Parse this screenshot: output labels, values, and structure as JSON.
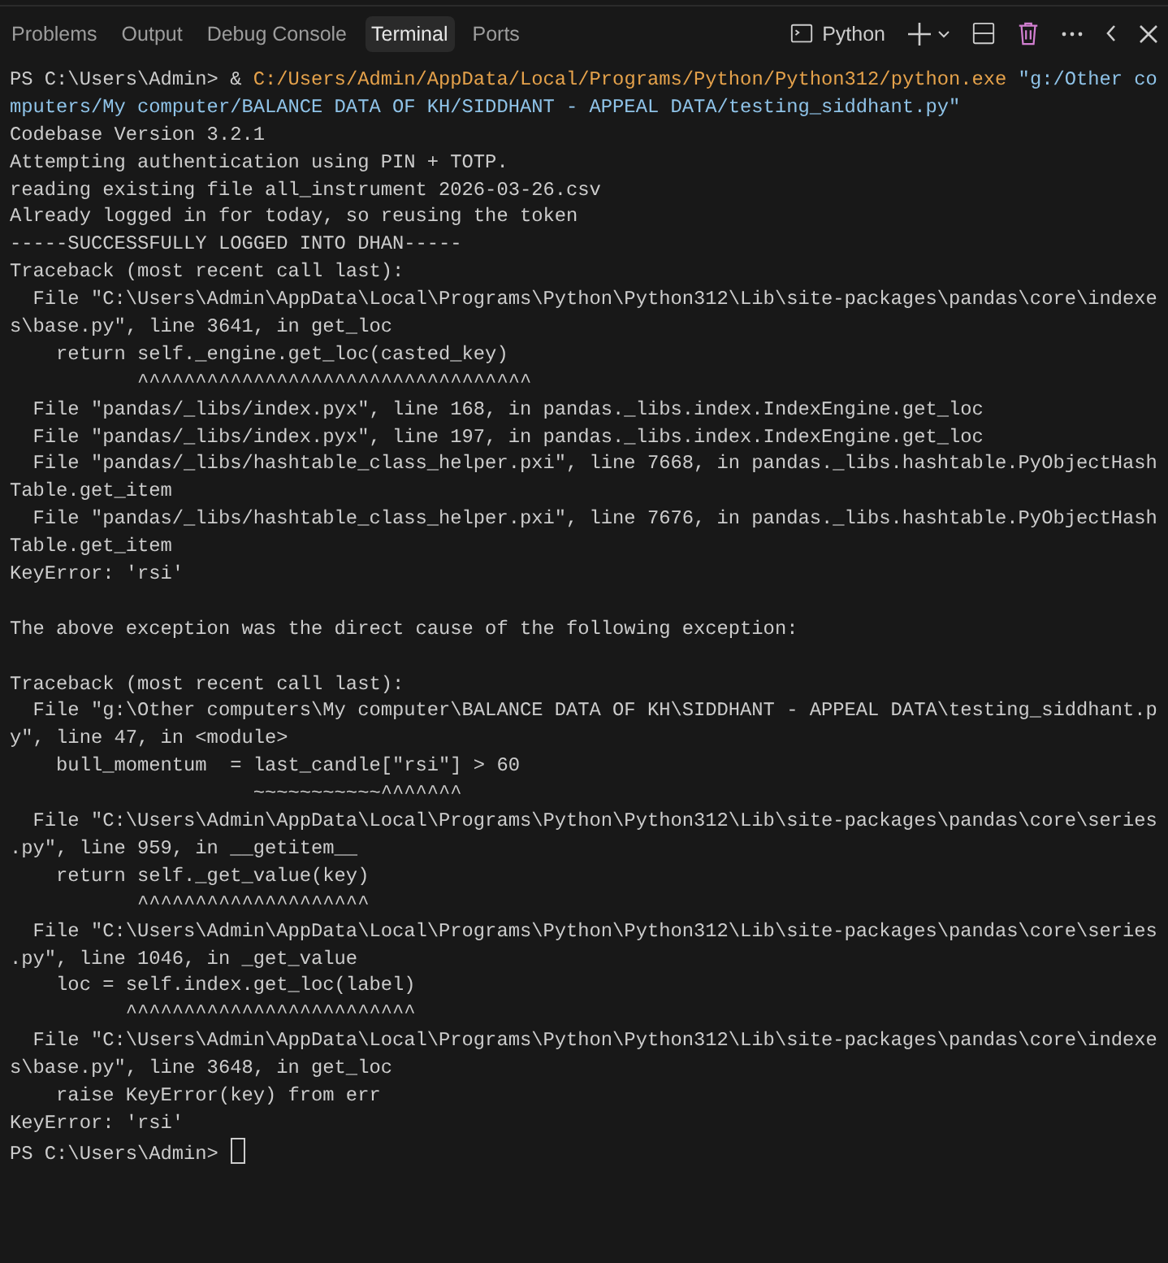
{
  "tabs": [
    {
      "label": "Problems",
      "selected": false
    },
    {
      "label": "Output",
      "selected": false
    },
    {
      "label": "Debug Console",
      "selected": false
    },
    {
      "label": "Terminal",
      "selected": true
    },
    {
      "label": "Ports",
      "selected": false
    }
  ],
  "toolbar": {
    "profile": "Python"
  },
  "terminal": {
    "blocks": [
      {
        "lines": [
          {
            "parts": [
              {
                "text": "PS C:\\Users\\Admin> & ",
                "kind": "plain"
              },
              {
                "text": "C:/Users/Admin/AppData/Local/Programs/Python/Python312/python.exe",
                "kind": "command"
              },
              {
                "text": " \"g:/Other co",
                "kind": "string"
              }
            ]
          },
          {
            "parts": [
              {
                "text": "mputers/My computer/BALANCE DATA OF KH/SIDDHANT - APPEAL DATA/testing_siddhant.py\"",
                "kind": "string"
              }
            ]
          },
          {
            "text": "Codebase Version 3.2.1"
          },
          {
            "text": "Attempting authentication using PIN + TOTP."
          },
          {
            "text": "reading existing file all_instrument 2026-03-26.csv"
          },
          {
            "text": "Already logged in for today, so reusing the token"
          },
          {
            "text": "-----SUCCESSFULLY LOGGED INTO DHAN-----"
          },
          {
            "text": "Traceback (most recent call last):"
          },
          {
            "text": "  File \"C:\\Users\\Admin\\AppData\\Local\\Programs\\Python\\Python312\\Lib\\site-packages\\pandas\\core\\indexe"
          },
          {
            "text": "s\\base.py\", line 3641, in get_loc"
          },
          {
            "text": "    return self._engine.get_loc(casted_key)"
          },
          {
            "text": "           ^^^^^^^^^^^^^^^^^^^^^^^^^^^^^^^^^^"
          },
          {
            "text": "  File \"pandas/_libs/index.pyx\", line 168, in pandas._libs.index.IndexEngine.get_loc"
          },
          {
            "text": "  File \"pandas/_libs/index.pyx\", line 197, in pandas._libs.index.IndexEngine.get_loc"
          },
          {
            "text": "  File \"pandas/_libs/hashtable_class_helper.pxi\", line 7668, in pandas._libs.hashtable.PyObjectHash"
          },
          {
            "text": "Table.get_item"
          },
          {
            "text": "  File \"pandas/_libs/hashtable_class_helper.pxi\", line 7676, in pandas._libs.hashtable.PyObjectHash"
          },
          {
            "text": "Table.get_item"
          },
          {
            "text": "KeyError: 'rsi'"
          }
        ]
      },
      {
        "lines": [
          {
            "text": "The above exception was the direct cause of the following exception:"
          }
        ]
      },
      {
        "lines": [
          {
            "text": "Traceback (most recent call last):"
          },
          {
            "text": "  File \"g:\\Other computers\\My computer\\BALANCE DATA OF KH\\SIDDHANT - APPEAL DATA\\testing_siddhant.p"
          },
          {
            "text": "y\", line 47, in <module>"
          },
          {
            "text": "    bull_momentum  = last_candle[\"rsi\"] > 60"
          },
          {
            "text": "                     ~~~~~~~~~~~^^^^^^^"
          },
          {
            "text": "  File \"C:\\Users\\Admin\\AppData\\Local\\Programs\\Python\\Python312\\Lib\\site-packages\\pandas\\core\\series"
          },
          {
            "text": ".py\", line 959, in __getitem__"
          },
          {
            "text": "    return self._get_value(key)"
          },
          {
            "text": "           ^^^^^^^^^^^^^^^^^^^^"
          },
          {
            "text": "  File \"C:\\Users\\Admin\\AppData\\Local\\Programs\\Python\\Python312\\Lib\\site-packages\\pandas\\core\\series"
          },
          {
            "text": ".py\", line 1046, in _get_value"
          },
          {
            "text": "    loc = self.index.get_loc(label)"
          },
          {
            "text": "          ^^^^^^^^^^^^^^^^^^^^^^^^^"
          },
          {
            "text": "  File \"C:\\Users\\Admin\\AppData\\Local\\Programs\\Python\\Python312\\Lib\\site-packages\\pandas\\core\\indexe"
          },
          {
            "text": "s\\base.py\", line 3648, in get_loc"
          },
          {
            "text": "    raise KeyError(key) from err"
          },
          {
            "text": "KeyError: 'rsi'"
          },
          {
            "text": "PS C:\\Users\\Admin> ",
            "cursor": true
          }
        ]
      }
    ]
  }
}
